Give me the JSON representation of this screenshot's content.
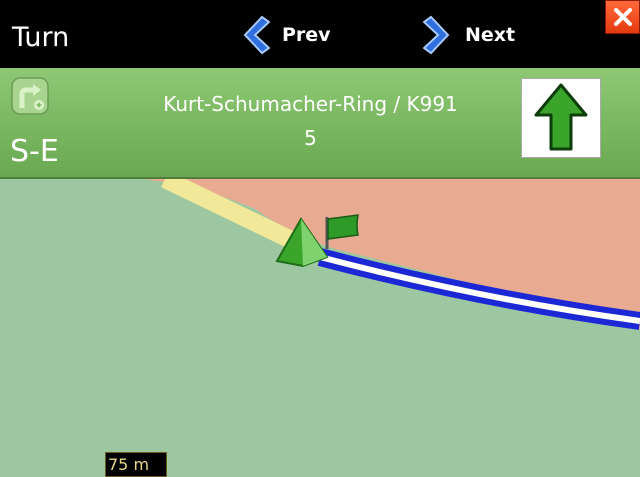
{
  "titlebar": {
    "title": "Turn",
    "prev_label": "Prev",
    "next_label": "Next"
  },
  "instruction": {
    "heading": "S-E",
    "street": "Kurt-Schumacher-Ring / K991",
    "distance": "5"
  },
  "map": {
    "scale_label": "75 m"
  },
  "icons": {
    "prev": "chevron-left-icon",
    "next": "chevron-right-icon",
    "close": "close-icon",
    "turn": "turn-right-icon",
    "direction": "arrow-up-icon",
    "position": "position-marker-icon",
    "destination": "flag-icon"
  },
  "colors": {
    "panel": "#7bb862",
    "map_green": "#9dc7a0",
    "map_orange": "#e8ab91",
    "route": "#1c28d6",
    "road": "#f2e89a",
    "accent_blue": "#2f6fe0",
    "close_red": "#e43a10"
  }
}
